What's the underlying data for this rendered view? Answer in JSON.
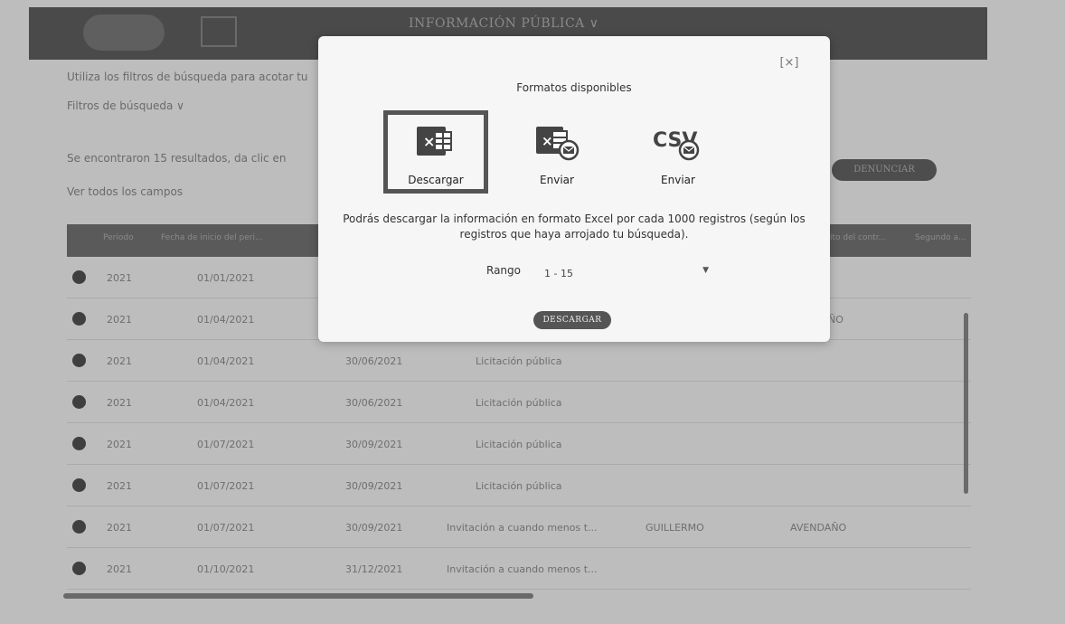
{
  "header": {
    "title": "INFORMACIÓN PÚBLICA ∨"
  },
  "page": {
    "intro": "Utiliza los filtros de búsqueda para acotar tu",
    "filters_toggle": "Filtros de búsqueda ∨",
    "results_text": "Se encontraron 15 resultados, da clic en",
    "view_all_fields": "Ver todos los campos",
    "report_button": "DENUNCIAR"
  },
  "table": {
    "headers": [
      "Periodo",
      "Fecha de inicio del peri...",
      "ito del contr...",
      "Segundo a..."
    ],
    "rows": [
      {
        "periodo": "2021",
        "inicio": "01/01/2021",
        "fin": "",
        "procedimiento": "",
        "nombre": "",
        "apellido": ""
      },
      {
        "periodo": "2021",
        "inicio": "01/04/2021",
        "fin": "",
        "procedimiento": "",
        "nombre": "",
        "apellido": "ÑO"
      },
      {
        "periodo": "2021",
        "inicio": "01/04/2021",
        "fin": "30/06/2021",
        "procedimiento": "Licitación pública",
        "nombre": "",
        "apellido": ""
      },
      {
        "periodo": "2021",
        "inicio": "01/04/2021",
        "fin": "30/06/2021",
        "procedimiento": "Licitación pública",
        "nombre": "",
        "apellido": ""
      },
      {
        "periodo": "2021",
        "inicio": "01/07/2021",
        "fin": "30/09/2021",
        "procedimiento": "Licitación pública",
        "nombre": "",
        "apellido": ""
      },
      {
        "periodo": "2021",
        "inicio": "01/07/2021",
        "fin": "30/09/2021",
        "procedimiento": "Licitación pública",
        "nombre": "",
        "apellido": ""
      },
      {
        "periodo": "2021",
        "inicio": "01/07/2021",
        "fin": "30/09/2021",
        "procedimiento": "Invitación a cuando menos t...",
        "nombre": "GUILLERMO",
        "apellido": "AVENDAÑO"
      },
      {
        "periodo": "2021",
        "inicio": "01/10/2021",
        "fin": "31/12/2021",
        "procedimiento": "Invitación a cuando menos t...",
        "nombre": "",
        "apellido": ""
      }
    ]
  },
  "modal": {
    "close_label": "[×]",
    "title": "Formatos disponibles",
    "formats": [
      {
        "label": "Descargar",
        "icon": "excel-icon",
        "selected": true
      },
      {
        "label": "Enviar",
        "icon": "excel-mail-icon",
        "selected": false
      },
      {
        "label": "Enviar",
        "icon": "csv-mail-icon",
        "selected": false
      }
    ],
    "description": "Podrás descargar la información en formato Excel por cada 1000 registros (según los registros que haya arrojado tu búsqueda).",
    "range_label": "Rango",
    "range_value": "1 - 15",
    "download_button": "DESCARGAR"
  },
  "colors": {
    "overlay_bg": "#bdbdbd",
    "modal_bg": "#f6f6f6",
    "dark_gray": "#555555"
  }
}
